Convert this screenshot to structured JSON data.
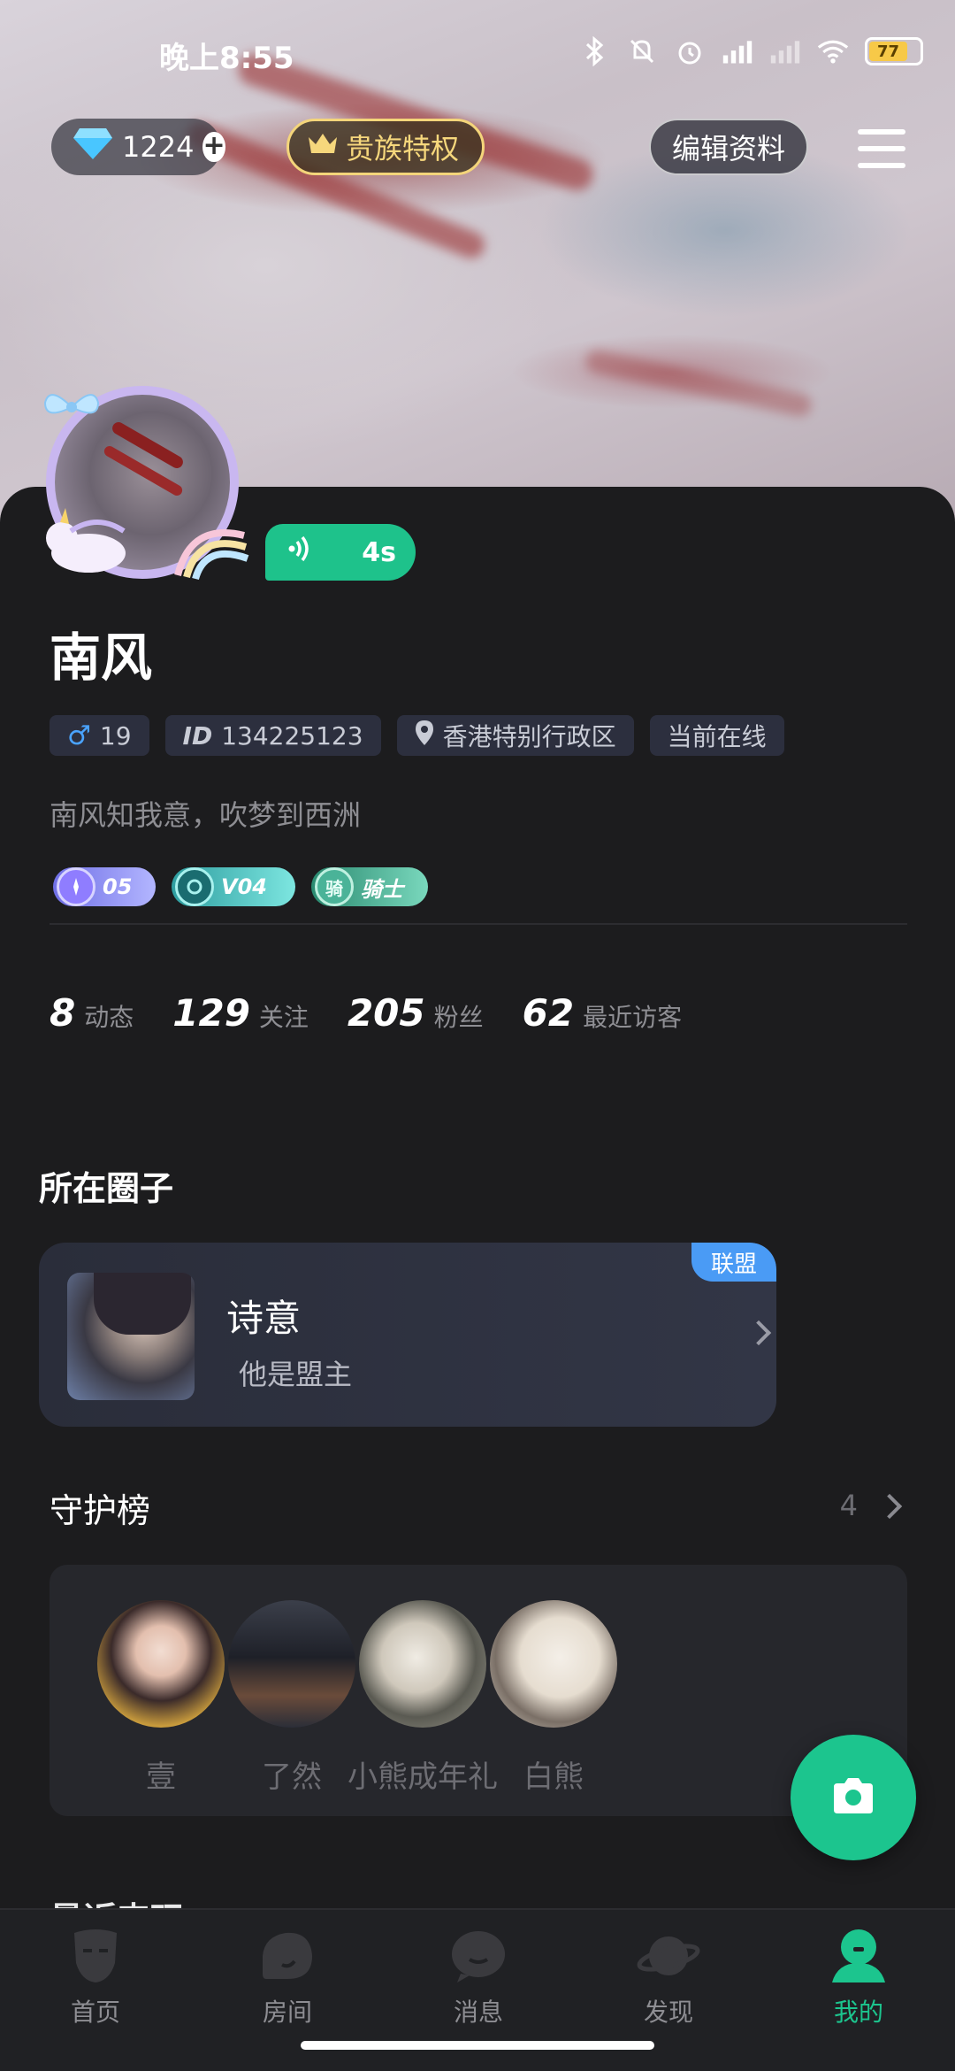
{
  "status_bar": {
    "time": "晚上8:55",
    "battery": "77"
  },
  "top_actions": {
    "diamonds": "1224",
    "noble_label": "贵族特权",
    "edit_label": "编辑资料"
  },
  "profile": {
    "voice_duration": "4s",
    "name": "南风",
    "age": "19",
    "id_label": "ID",
    "id_value": "134225123",
    "location": "香港特别行政区",
    "online_status": "当前在线",
    "bio": "南风知我意，吹梦到西洲",
    "badges": [
      {
        "label": "05"
      },
      {
        "label": "V04"
      },
      {
        "icon_text": "骑",
        "label": "骑士"
      }
    ]
  },
  "stats": [
    {
      "num": "8",
      "label": "动态"
    },
    {
      "num": "129",
      "label": "关注"
    },
    {
      "num": "205",
      "label": "粉丝"
    },
    {
      "num": "62",
      "label": "最近访客"
    }
  ],
  "circle": {
    "section_title": "所在圈子",
    "name": "诗意",
    "role": "他是盟主",
    "tag": "联盟"
  },
  "guard": {
    "section_title": "守护榜",
    "count": "4",
    "members": [
      {
        "name": "壹"
      },
      {
        "name": "了然"
      },
      {
        "name": "小熊成年礼"
      },
      {
        "name": "白熊"
      }
    ]
  },
  "peek_section_title": "最近来玩",
  "nav": [
    {
      "label": "首页",
      "icon": "mask-icon"
    },
    {
      "label": "房间",
      "icon": "room-icon"
    },
    {
      "label": "消息",
      "icon": "message-icon"
    },
    {
      "label": "发现",
      "icon": "planet-icon"
    },
    {
      "label": "我的",
      "icon": "profile-icon",
      "active": true
    }
  ],
  "colors": {
    "accent": "#1cc58e",
    "background": "#1c1c1e",
    "league_tag": "#4a9bf5",
    "noble_gold": "#f4d57a"
  }
}
